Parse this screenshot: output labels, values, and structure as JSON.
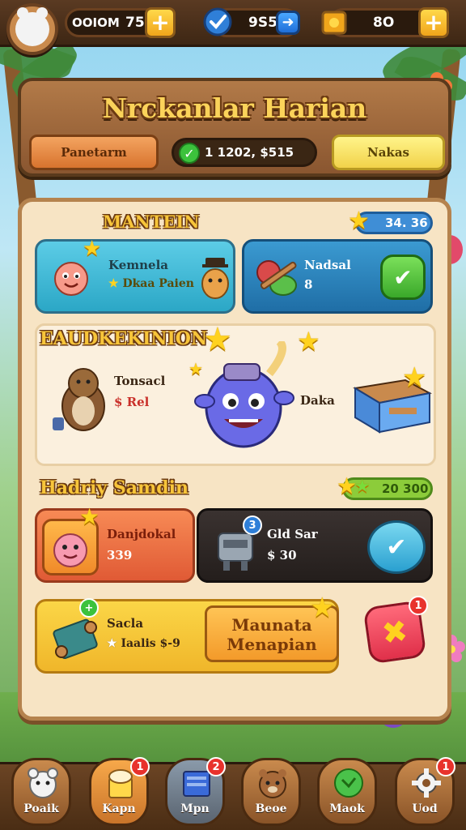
{
  "top_bar": {
    "resource_1": {
      "label": "OOIOM",
      "value": "75"
    },
    "resource_2": {
      "value": "9S5"
    },
    "resource_3": {
      "value": "8O"
    }
  },
  "header": {
    "title": "Nrckanlar Harian",
    "left_button": "Panetarm",
    "progress_text": "1 1202, $515",
    "right_button": "Nakas"
  },
  "section_1": {
    "title": "MANTEIN",
    "star_value": "34. 36",
    "card_left": {
      "line1": "Kemnela",
      "line2": "Dkaa Paien"
    },
    "card_right": {
      "line1": "Nadsal",
      "line2": "8"
    }
  },
  "section_2": {
    "title": "EAUDKEKINION",
    "left_name": "Tonsacl",
    "left_value": "$ Rel",
    "right_label": "Daka"
  },
  "section_3": {
    "title": "Hadriy Samdin",
    "star_value": "20 300",
    "card_left": {
      "line1": "Danjdokal",
      "line2": "339"
    },
    "card_right": {
      "line1": "Gld Sar",
      "line2": "$ 30"
    },
    "card_right_badge": "3",
    "bottom_card": {
      "line1": "Sacla",
      "line2": "Iaalis $-9"
    },
    "big_button": {
      "line1": "Maunata",
      "line2": "Menapian"
    },
    "close_badge": "1"
  },
  "bottom_nav": [
    {
      "label": "Poaik",
      "badge": ""
    },
    {
      "label": "Kapn",
      "badge": "1"
    },
    {
      "label": "Mpn",
      "badge": "2"
    },
    {
      "label": "Beoe",
      "badge": ""
    },
    {
      "label": "Maok",
      "badge": ""
    },
    {
      "label": "Uod",
      "badge": "1"
    }
  ],
  "colors": {
    "accent": "#f7c53a",
    "panel": "#f7e4c4",
    "wood": "#8a5630"
  }
}
